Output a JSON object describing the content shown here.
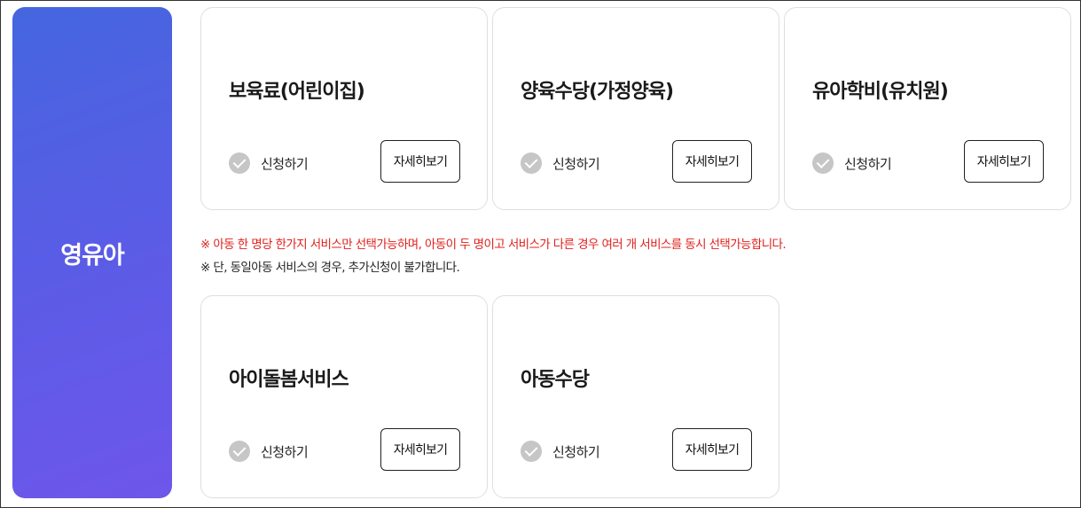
{
  "category": {
    "title": "영유아"
  },
  "cards_top": [
    {
      "title": "보육료(어린이집)",
      "apply_label": "신청하기",
      "detail_label": "자세히보기"
    },
    {
      "title": "양육수당(가정양육)",
      "apply_label": "신청하기",
      "detail_label": "자세히보기"
    },
    {
      "title": "유아학비(유치원)",
      "apply_label": "신청하기",
      "detail_label": "자세히보기"
    }
  ],
  "notices": {
    "primary": "※ 아동 한 명당 한가지 서비스만 선택가능하며, 아동이 두 명이고 서비스가 다른 경우 여러 개 서비스를 동시 선택가능합니다.",
    "secondary": "※ 단, 동일아동 서비스의 경우, 추가신청이 불가합니다."
  },
  "cards_bottom": [
    {
      "title": "아이돌봄서비스",
      "apply_label": "신청하기",
      "detail_label": "자세히보기"
    },
    {
      "title": "아동수당",
      "apply_label": "신청하기",
      "detail_label": "자세히보기"
    }
  ],
  "colors": {
    "gradient_start": "#4566df",
    "gradient_end": "#6e56ea",
    "notice_red": "#e0201c",
    "check_gray": "#c6c6c6"
  },
  "icons": {
    "apply": "check-circle-icon"
  }
}
